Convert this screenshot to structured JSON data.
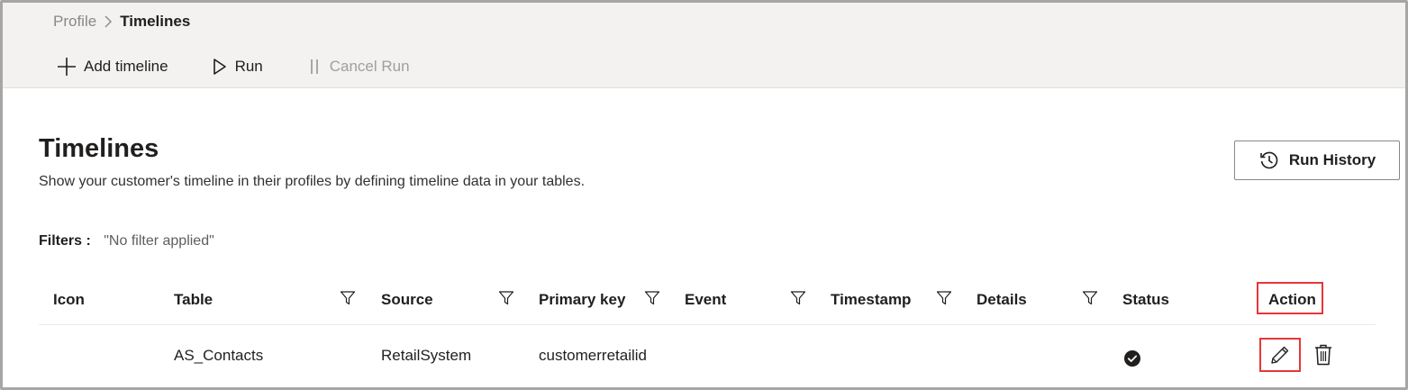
{
  "breadcrumb": {
    "parent": "Profile",
    "current": "Timelines"
  },
  "toolbar": {
    "add_timeline": "Add timeline",
    "run": "Run",
    "cancel_run": "Cancel Run"
  },
  "header": {
    "title": "Timelines",
    "subtitle": "Show your customer's timeline in their profiles by defining timeline data in your tables.",
    "run_history": "Run History"
  },
  "filters": {
    "label": "Filters :",
    "value": "\"No filter applied\""
  },
  "table": {
    "columns": {
      "icon": "Icon",
      "table": "Table",
      "source": "Source",
      "primary_key": "Primary key",
      "event": "Event",
      "timestamp": "Timestamp",
      "details": "Details",
      "status": "Status",
      "action": "Action"
    },
    "rows": [
      {
        "icon": "",
        "table": "AS_Contacts",
        "source": "RetailSystem",
        "primary_key": "customerretailid",
        "event": "",
        "timestamp": "",
        "details": "",
        "status_icon": "check-circle-icon"
      }
    ]
  },
  "colors": {
    "highlight": "#e5373a",
    "topbar": "#f3f2f1"
  }
}
